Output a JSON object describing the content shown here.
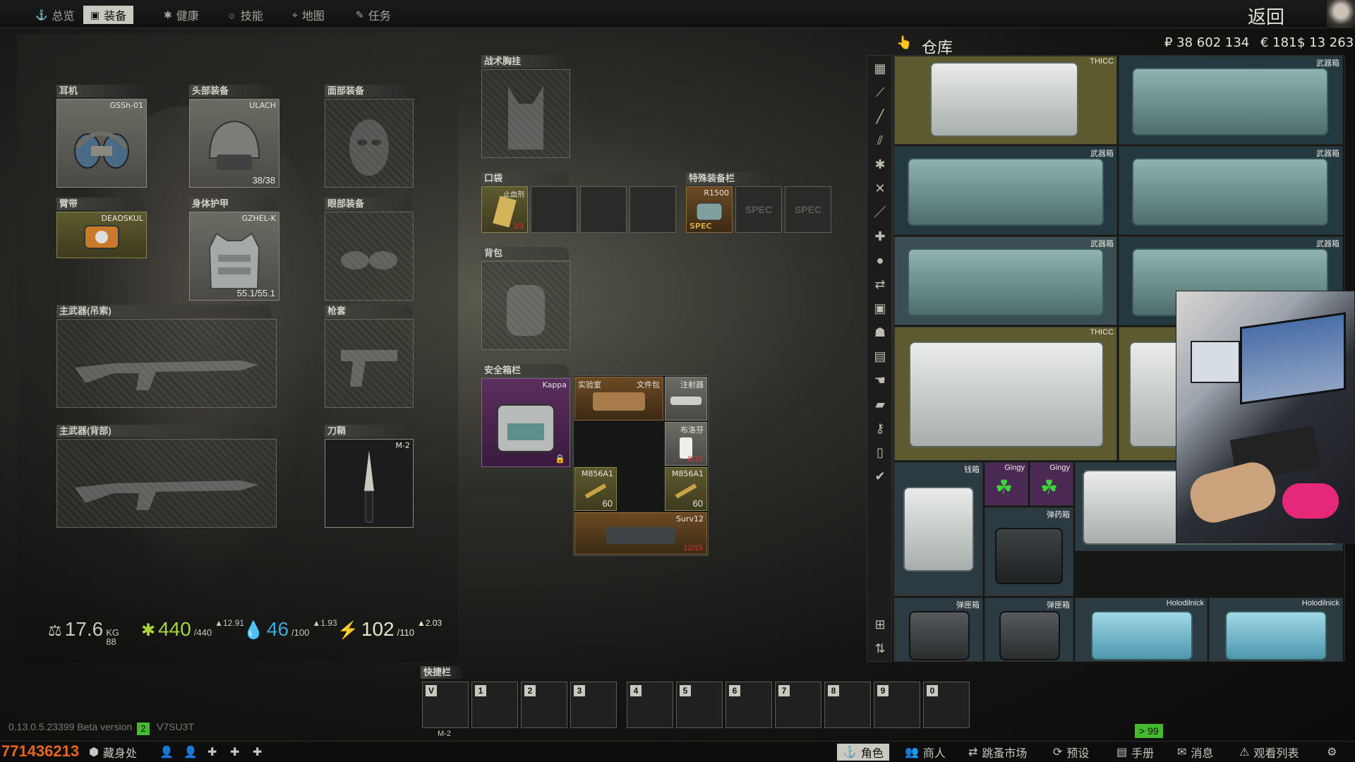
{
  "nav": {
    "tabs": [
      {
        "label": "总览",
        "icon": "anchor-icon"
      },
      {
        "label": "装备",
        "icon": "gear-icon"
      },
      {
        "label": "健康",
        "icon": "health-icon"
      },
      {
        "label": "技能",
        "icon": "skills-icon"
      },
      {
        "label": "地图",
        "icon": "map-pin-icon"
      },
      {
        "label": "任务",
        "icon": "tasks-icon"
      }
    ],
    "back_label": "返回"
  },
  "equipment": {
    "earpiece": {
      "label": "耳机",
      "item": "GSSh-01"
    },
    "headwear": {
      "label": "头部装备",
      "item": "ULACH",
      "durability": "38/38"
    },
    "face_cover": {
      "label": "面部装备"
    },
    "armband": {
      "label": "臂带",
      "item": "DEADSKUL"
    },
    "body_armor": {
      "label": "身体护甲",
      "item": "GZHEL-K",
      "durability": "55.1/55.1"
    },
    "eyewear": {
      "label": "眼部装备"
    },
    "primary_sling": {
      "label": "主武器(吊索)"
    },
    "holster": {
      "label": "枪套"
    },
    "primary_back": {
      "label": "主武器(背部)"
    },
    "scabbard": {
      "label": "刀鞘",
      "item": "M-2"
    }
  },
  "containers": {
    "tactical_rig": {
      "label": "战术胸挂"
    },
    "pockets": {
      "label": "口袋",
      "items": [
        {
          "name": "止血剂",
          "count": "3/3"
        }
      ]
    },
    "special_slots": {
      "label": "特殊装备栏",
      "items": [
        {
          "name": "R1500",
          "tag": "SPEC"
        }
      ],
      "placeholders": [
        "SPEC",
        "SPEC"
      ]
    },
    "backpack": {
      "label": "背包"
    },
    "secure_container": {
      "label": "安全箱栏",
      "case_name": "Kappa",
      "items": [
        {
          "name": "实验室",
          "pos": "a"
        },
        {
          "name": "文件包",
          "pos": "b"
        },
        {
          "name": "注射器",
          "pos": "c"
        },
        {
          "name": "布洛芬",
          "count": "8/15"
        },
        {
          "name": "M856A1",
          "count": "60"
        },
        {
          "name": "M856A1",
          "count": "60"
        },
        {
          "name": "Surv12",
          "count": "12/15"
        }
      ]
    }
  },
  "stats": {
    "weight": {
      "value": "17.6",
      "unit": "KG",
      "max": "88"
    },
    "health": {
      "value": "440",
      "max": "/440",
      "rate": "▲12.91"
    },
    "hydration": {
      "value": "46",
      "max": "/100",
      "rate": "▲1.93"
    },
    "energy": {
      "value": "102",
      "max": "/110",
      "rate": "▲2.03"
    }
  },
  "stash": {
    "title": "仓库",
    "rubles": "₽ 38 602 134",
    "euros": "€ 181",
    "dollars": "$ 13 263",
    "tags": {
      "thicc": "THICC",
      "weapon": "武器箱",
      "money": "钱箱",
      "gingy": "Gingy",
      "ammo": "弹药箱",
      "grenade": "弹匣箱",
      "holodilnick": "Holodilnick"
    },
    "sidebar_icons": [
      "grid-icon",
      "knife-icon",
      "weapon-icon",
      "ammo-icon",
      "gear-icon",
      "crossed-icon",
      "pen-icon",
      "medical-icon",
      "grenade-icon",
      "swap-icon",
      "armor-icon",
      "bag-icon",
      "case-icon",
      "barter-icon",
      "book-icon",
      "key-icon",
      "map-icon",
      "check-icon"
    ]
  },
  "quickbar": {
    "title": "快捷栏",
    "keys": [
      "V",
      "1",
      "2",
      "3",
      "4",
      "5",
      "6",
      "7",
      "8",
      "9",
      "0"
    ],
    "v_item": "M-2"
  },
  "footer": {
    "version": "0.13.0.5.23399 Beta version",
    "session": "V7SU3T",
    "fps_badge": "2",
    "player_id": "771436213",
    "hideout_label": "藏身处",
    "counter": "> 99",
    "menu": [
      {
        "label": "角色",
        "icon": "character-icon"
      },
      {
        "label": "商人",
        "icon": "traders-icon"
      },
      {
        "label": "跳蚤市场",
        "icon": "flea-market-icon"
      },
      {
        "label": "预设",
        "icon": "presets-icon"
      },
      {
        "label": "手册",
        "icon": "handbook-icon"
      },
      {
        "label": "消息",
        "icon": "messages-icon"
      },
      {
        "label": "观看列表",
        "icon": "watchlist-icon"
      }
    ]
  },
  "colors": {
    "accent": "#c9c9c0",
    "health": "#a9d43a",
    "hydration": "#3fa8d8",
    "energy": "#e8e4c8",
    "warn_red": "#d32f2f",
    "orange_id": "#e8651a",
    "green_badge": "#44b82e"
  }
}
